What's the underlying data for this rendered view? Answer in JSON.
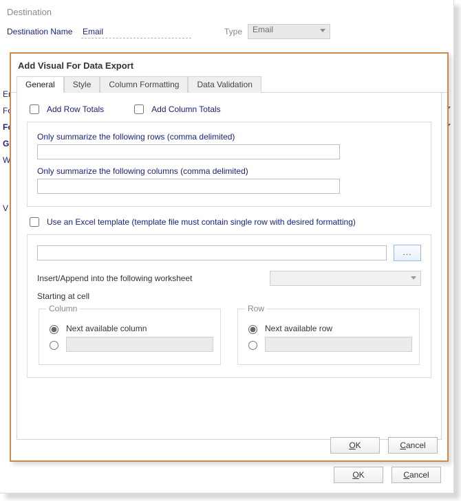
{
  "bg": {
    "section": "Destination",
    "name_label": "Destination Name",
    "name_value": "Email",
    "type_label": "Type",
    "type_value": "Email",
    "faded": {
      "a": "En",
      "b": "Fo",
      "c": "Fo",
      "d": "Ge",
      "e": "Wo",
      "f": "V"
    },
    "ok": "OK",
    "cancel": "Cancel",
    "ok_u": "O",
    "cancel_u": "C"
  },
  "dlg": {
    "title": "Add Visual For Data Export",
    "tabs": {
      "general": "General",
      "style": "Style",
      "colfmt": "Column Formatting",
      "dataval": "Data Validation"
    },
    "add_row_totals": "Add Row Totals",
    "add_col_totals": "Add Column Totals",
    "sum_rows_label": "Only summarize the following rows (comma delimited)",
    "sum_cols_label": "Only summarize the following columns (comma delimited)",
    "use_excel_tpl": "Use an Excel template (template file must contain single row with desired formatting)",
    "browse": "...",
    "insert_label": "Insert/Append into the following worksheet",
    "starting_at": "Starting at cell",
    "col_legend": "Column",
    "row_legend": "Row",
    "next_col": "Next available column",
    "next_row": "Next available row",
    "ok": "OK",
    "cancel": "Cancel",
    "ok_u": "O",
    "cancel_u": "C"
  }
}
